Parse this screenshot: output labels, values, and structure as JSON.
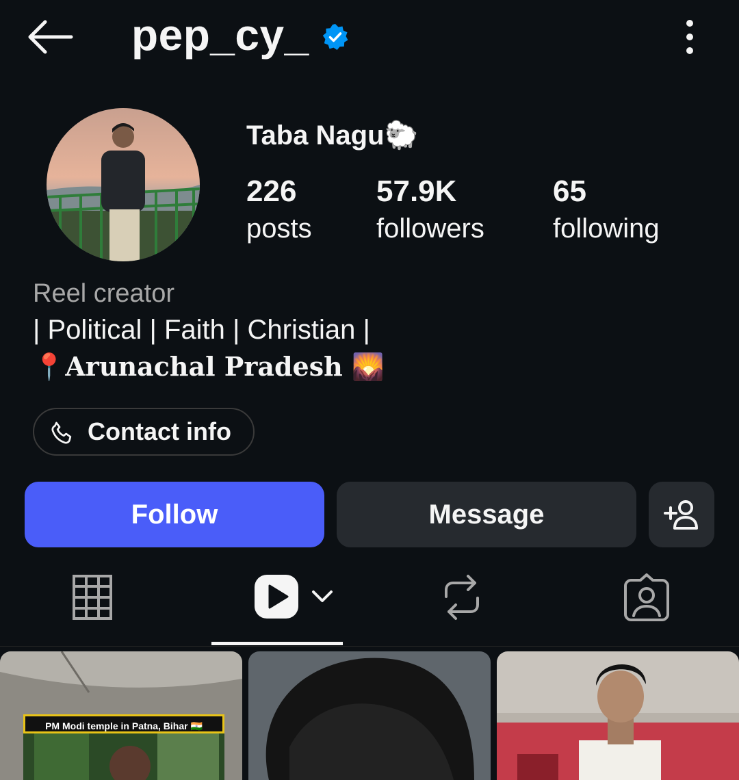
{
  "header": {
    "username": "pep_cy_",
    "verified": true,
    "back_icon": "arrow-left-icon",
    "more_icon": "more-vertical-icon"
  },
  "profile": {
    "display_name": "Taba Nagu🐑",
    "stats": [
      {
        "value": "226",
        "label": "posts"
      },
      {
        "value": "57.9K",
        "label": "followers"
      },
      {
        "value": "65",
        "label": "following"
      }
    ],
    "bio": {
      "category": "Reel creator",
      "line1": "| Political | Faith | Christian |",
      "line2": "📍𝐀𝐫𝐮𝐧𝐚𝐜𝐡𝐚𝐥 𝐏𝐫𝐚𝐝𝐞𝐬𝐡 🌄"
    },
    "contact_label": "Contact info"
  },
  "actions": {
    "follow_label": "Follow",
    "message_label": "Message",
    "add_user_icon": "add-user-icon"
  },
  "tabs": [
    {
      "icon": "grid-icon",
      "active": false
    },
    {
      "icon": "reels-icon",
      "active": true
    },
    {
      "icon": "reposts-icon",
      "active": false
    },
    {
      "icon": "tagged-icon",
      "active": false
    }
  ],
  "grid": {
    "thumbnails": [
      {
        "caption": "PM Modi temple in Patna, Bihar 🇮🇳"
      },
      {
        "caption": ""
      },
      {
        "caption": ""
      }
    ]
  },
  "colors": {
    "background": "#0c1014",
    "follow_button": "#4a5df9",
    "secondary_button": "#262a2f",
    "verified_badge": "#0095f6",
    "muted_text": "#a8a8a8"
  }
}
